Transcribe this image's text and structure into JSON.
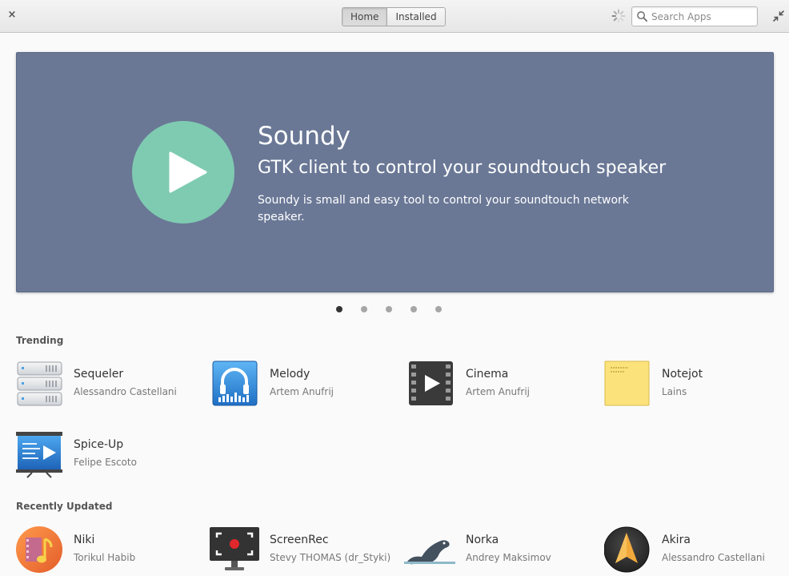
{
  "header": {
    "close_label": "×",
    "tabs": [
      {
        "label": "Home",
        "active": true
      },
      {
        "label": "Installed",
        "active": false
      }
    ],
    "search": {
      "placeholder": "Search Apps",
      "value": ""
    }
  },
  "banner": {
    "name": "Soundy",
    "summary": "GTK client to control your soundtouch speaker",
    "description": "Soundy is small and easy tool to control your soundtouch network speaker.",
    "icon": "play-icon",
    "background": "#6a7896",
    "icon_color": "#7fcbb1"
  },
  "carousel": {
    "count": 5,
    "active_index": 0
  },
  "trending": {
    "title": "Trending",
    "apps": [
      {
        "name": "Sequeler",
        "author": "Alessandro Castellani",
        "icon": "database-server-icon"
      },
      {
        "name": "Melody",
        "author": "Artem Anufrij",
        "icon": "headphones-icon"
      },
      {
        "name": "Cinema",
        "author": "Artem Anufrij",
        "icon": "film-play-icon"
      },
      {
        "name": "Notejot",
        "author": "Lains",
        "icon": "sticky-note-icon"
      },
      {
        "name": "Spice-Up",
        "author": "Felipe Escoto",
        "icon": "presentation-icon"
      }
    ]
  },
  "recently_updated": {
    "title": "Recently Updated",
    "apps": [
      {
        "name": "Niki",
        "author": "Torikul Habib",
        "icon": "music-film-icon"
      },
      {
        "name": "ScreenRec",
        "author": "Stevy THOMAS (dr_Styki)",
        "icon": "screen-record-icon"
      },
      {
        "name": "Norka",
        "author": "Andrey Maksimov",
        "icon": "seal-icon"
      },
      {
        "name": "Akira",
        "author": "Alessandro Castellani",
        "icon": "akira-icon"
      }
    ]
  }
}
